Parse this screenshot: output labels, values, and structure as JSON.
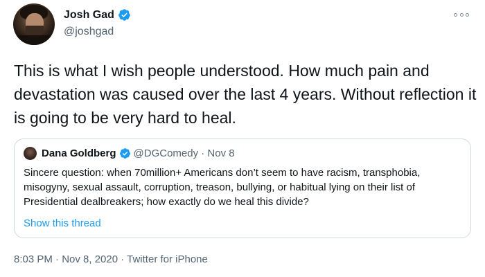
{
  "tweet": {
    "author_name": "Josh Gad",
    "author_handle": "@joshgad",
    "text": "This is what I wish people understood. How much pain and devastation was caused over the last 4 years. Without reflection it is going to be very hard to heal.",
    "timestamp": "8:03 PM · Nov 8, 2020 · Twitter for iPhone",
    "verified_icon": "verified-badge-icon",
    "more_icon": "more-options-icon"
  },
  "quote": {
    "author_name": "Dana Goldberg",
    "author_handle_and_date": "@DGComedy · Nov 8",
    "text": "Sincere question: when 70million+ Americans don’t seem to have racism, transphobia, misogyny, sexual assault, corruption, treason, bullying, or habitual lying on their list of Presidential dealbreakers; how exactly do we heal this divide?",
    "show_thread": "Show this thread"
  },
  "colors": {
    "accent": "#1d9bf0",
    "text": "#0f1419",
    "muted": "#536471",
    "border": "#cfd9de"
  }
}
